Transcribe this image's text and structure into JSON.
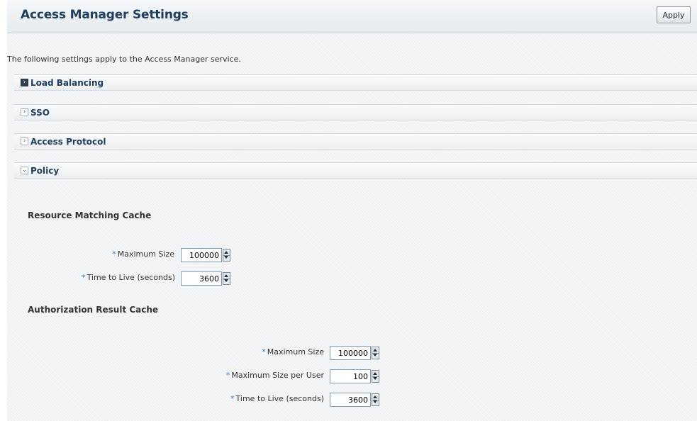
{
  "header": {
    "title": "Access Manager Settings",
    "apply_label": "Apply"
  },
  "intro_text": "The following settings apply to the Access Manager service.",
  "sections": [
    {
      "label": "Load Balancing",
      "expanded": false,
      "icon": "chevron-right-icon"
    },
    {
      "label": "SSO",
      "expanded": false,
      "icon": "chevron-right-icon"
    },
    {
      "label": "Access Protocol",
      "expanded": false,
      "icon": "chevron-right-icon"
    },
    {
      "label": "Policy",
      "expanded": true,
      "icon": "chevron-down-icon"
    }
  ],
  "policy": {
    "resource_cache": {
      "title": "Resource Matching Cache",
      "fields": [
        {
          "label": "Maximum Size",
          "required_mark": "*",
          "value": "100000"
        },
        {
          "label": "Time to Live (seconds)",
          "required_mark": "*",
          "value": "3600"
        }
      ]
    },
    "authorization_cache": {
      "title": "Authorization Result Cache",
      "fields": [
        {
          "label": "Maximum Size",
          "required_mark": "*",
          "value": "100000"
        },
        {
          "label": "Maximum Size per User",
          "required_mark": "*",
          "value": "100"
        },
        {
          "label": "Time to Live (seconds)",
          "required_mark": "*",
          "value": "3600"
        }
      ]
    }
  },
  "colors": {
    "title": "#1f3d5c",
    "required_mark": "#3b7fc4",
    "active_disclosure": "#2d3e50"
  }
}
